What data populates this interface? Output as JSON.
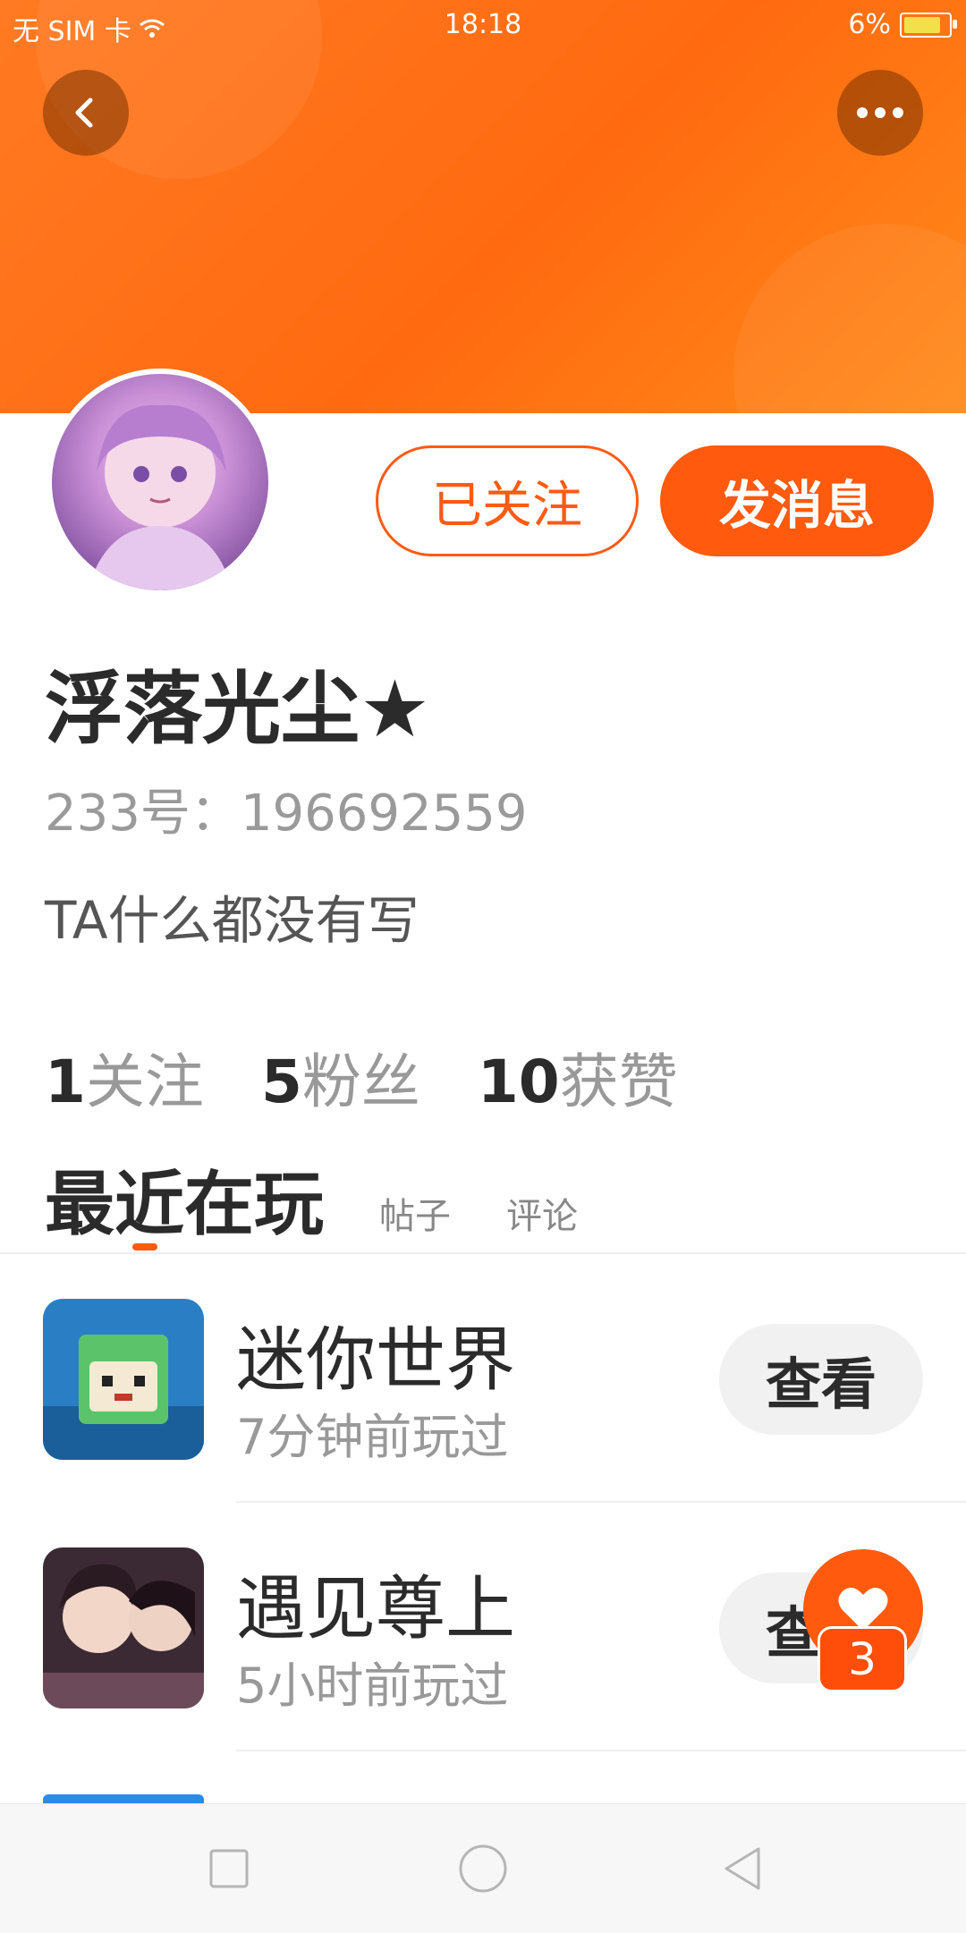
{
  "status_bar": {
    "carrier": "无 SIM 卡",
    "time": "18:18",
    "battery": "6%",
    "icons": [
      "wifi-icon",
      "battery-charging-icon"
    ]
  },
  "header": {
    "back_icon": "chevron-left-icon",
    "more_icon": "more-dots-icon",
    "colors": {
      "gradient_start": "#ff7a22",
      "gradient_end": "#ff8a1a"
    }
  },
  "profile": {
    "follow_button": "已关注",
    "message_button": "发消息",
    "name": "浮落光尘★",
    "id_text": "233号：196692559",
    "bio": "TA什么都没有写",
    "stats": [
      {
        "num": "1",
        "label": "关注"
      },
      {
        "num": "5",
        "label": "粉丝"
      },
      {
        "num": "10",
        "label": "获赞"
      }
    ]
  },
  "tabs": {
    "active": "最近在玩",
    "items": [
      "帖子",
      "评论"
    ]
  },
  "games": [
    {
      "name": "迷你世界",
      "time": "7分钟前玩过",
      "button": "查看"
    },
    {
      "name": "遇见尊上",
      "time": "5小时前玩过",
      "button": "查看"
    }
  ],
  "fab": {
    "icon": "heart-icon",
    "count": "3"
  },
  "nav": {
    "icons": [
      "square-recent-icon",
      "circle-home-icon",
      "triangle-back-icon"
    ]
  },
  "accent_color": "#ff5a14"
}
